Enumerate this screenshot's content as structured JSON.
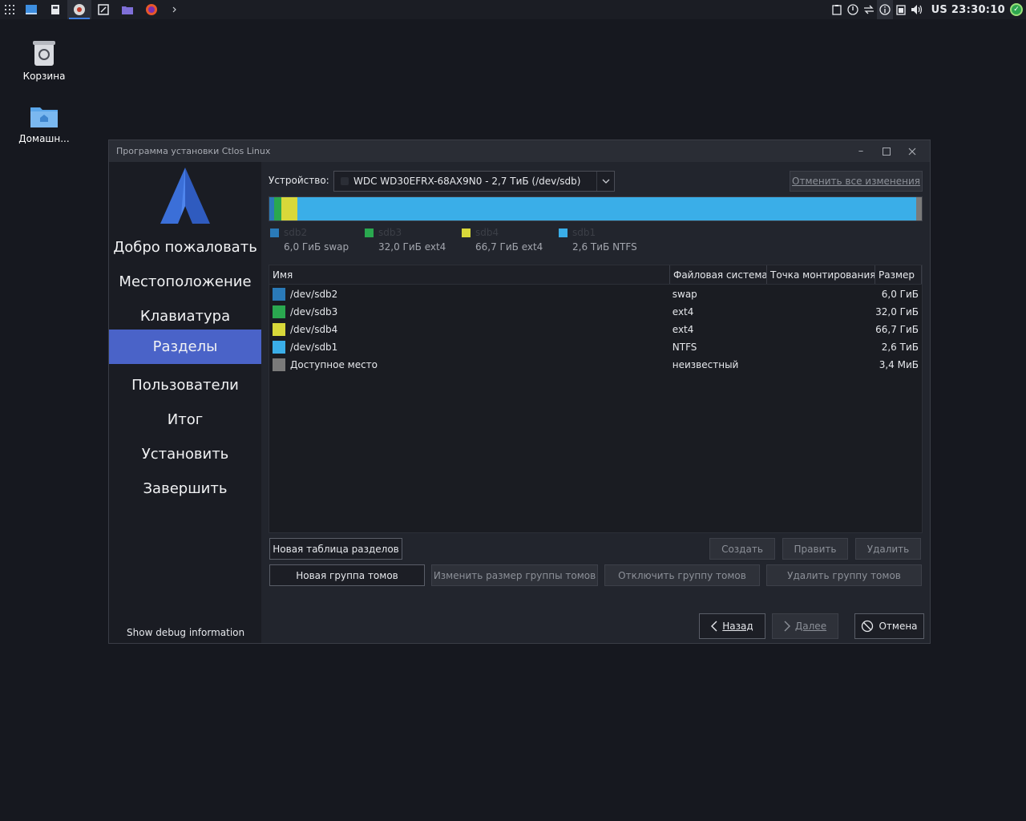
{
  "panel": {
    "launchers": [
      "apps-grid-icon",
      "desktop-icon",
      "file-icon",
      "installer-icon",
      "editor-icon",
      "folder-icon",
      "firefox-icon",
      "terminal-icon"
    ],
    "clock": "US 23:30:10"
  },
  "desktop": {
    "icons": [
      {
        "label": "Корзина"
      },
      {
        "label": "Домашн..."
      }
    ]
  },
  "window": {
    "title": "Программа установки Ctlos Linux"
  },
  "sidebar": {
    "items": [
      {
        "label": "Добро пожаловать"
      },
      {
        "label": "Местоположение"
      },
      {
        "label": "Клавиатура"
      },
      {
        "label": "Разделы"
      },
      {
        "label": "Пользователи"
      },
      {
        "label": "Итог"
      },
      {
        "label": "Установить"
      },
      {
        "label": "Завершить"
      }
    ],
    "active_index": 3,
    "debug_label": "Show debug information"
  },
  "device": {
    "label": "Устройство:",
    "selected": "WDC WD30EFRX-68AX9N0 - 2,7 ТиБ (/dev/sdb)",
    "revert_label": "Отменить все изменения"
  },
  "legend": [
    {
      "name": "sdb2",
      "info": "6,0 ГиБ  swap",
      "color": "#2a7ab8"
    },
    {
      "name": "sdb3",
      "info": "32,0 ГиБ  ext4",
      "color": "#2aa84f"
    },
    {
      "name": "sdb4",
      "info": "66,7 ГиБ  ext4",
      "color": "#d8d83a"
    },
    {
      "name": "sdb1",
      "info": "2,6 ТиБ  NTFS",
      "color": "#3aaee8"
    }
  ],
  "table": {
    "headers": [
      "Имя",
      "Файловая система",
      "Точка монтирования",
      "Размер"
    ],
    "rows": [
      {
        "name": "/dev/sdb2",
        "fs": "swap",
        "mount": "",
        "size": "6,0 ГиБ",
        "color": "#2a7ab8"
      },
      {
        "name": "/dev/sdb3",
        "fs": "ext4",
        "mount": "",
        "size": "32,0 ГиБ",
        "color": "#2aa84f"
      },
      {
        "name": "/dev/sdb4",
        "fs": "ext4",
        "mount": "",
        "size": "66,7 ГиБ",
        "color": "#d8d83a"
      },
      {
        "name": "/dev/sdb1",
        "fs": "NTFS",
        "mount": "",
        "size": "2,6 ТиБ",
        "color": "#3aaee8"
      },
      {
        "name": "Доступное место",
        "fs": "неизвестный",
        "mount": "",
        "size": "3,4 МиБ",
        "color": "#7a7a7a"
      }
    ]
  },
  "actions": {
    "new_table": "Новая таблица разделов",
    "create": "Создать",
    "edit": "Править",
    "delete": "Удалить",
    "new_vg": "Новая группа томов",
    "resize_vg": "Изменить размер группы томов",
    "deactivate_vg": "Отключить группу томов",
    "remove_vg": "Удалить группу томов"
  },
  "navigation": {
    "back": "Назад",
    "next": "Далее",
    "cancel": "Отмена"
  }
}
